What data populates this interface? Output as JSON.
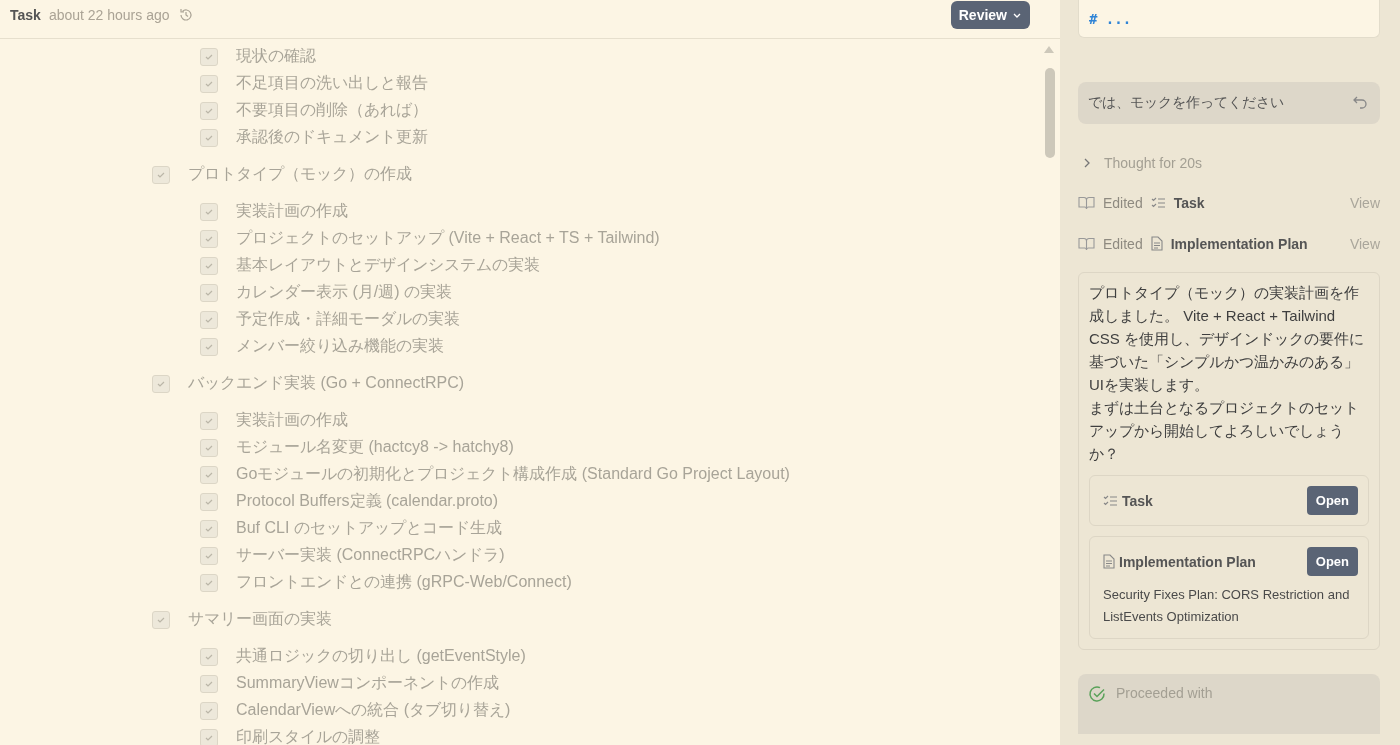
{
  "header": {
    "title": "Task",
    "timestamp": "about 22 hours ago",
    "review_button": "Review"
  },
  "task_list": {
    "continued_items": [
      {
        "label": "現状の確認",
        "checked": true
      },
      {
        "label": "不足項目の洗い出しと報告",
        "checked": true
      },
      {
        "label": "不要項目の削除（あれば）",
        "checked": true
      },
      {
        "label": "承認後のドキュメント更新",
        "checked": true
      }
    ],
    "sections": [
      {
        "label": "プロトタイプ（モック）の作成",
        "checked": true,
        "children": [
          {
            "label": "実装計画の作成",
            "checked": true
          },
          {
            "label": "プロジェクトのセットアップ (Vite + React + TS + Tailwind)",
            "checked": true
          },
          {
            "label": "基本レイアウトとデザインシステムの実装",
            "checked": true
          },
          {
            "label": "カレンダー表示 (月/週) の実装",
            "checked": true
          },
          {
            "label": "予定作成・詳細モーダルの実装",
            "checked": true
          },
          {
            "label": "メンバー絞り込み機能の実装",
            "checked": true
          }
        ]
      },
      {
        "label": "バックエンド実装 (Go + ConnectRPC)",
        "checked": true,
        "children": [
          {
            "label": "実装計画の作成",
            "checked": true
          },
          {
            "label": "モジュール名変更 (hactcy8 -> hatchy8)",
            "checked": true
          },
          {
            "label": "Goモジュールの初期化とプロジェクト構成作成 (Standard Go Project Layout)",
            "checked": true
          },
          {
            "label": "Protocol Buffers定義 (calendar.proto)",
            "checked": true
          },
          {
            "label": "Buf CLI のセットアップとコード生成",
            "checked": true
          },
          {
            "label": "サーバー実装 (ConnectRPCハンドラ)",
            "checked": true
          },
          {
            "label": "フロントエンドとの連携 (gRPC-Web/Connect)",
            "checked": true
          }
        ]
      },
      {
        "label": "サマリー画面の実装",
        "checked": true,
        "children": [
          {
            "label": "共通ロジックの切り出し (getEventStyle)",
            "checked": true
          },
          {
            "label": "SummaryViewコンポーネントの作成",
            "checked": true
          },
          {
            "label": "CalendarViewへの統合 (タブ切り替え)",
            "checked": true
          },
          {
            "label": "印刷スタイルの調整",
            "checked": true
          }
        ]
      }
    ]
  },
  "chat": {
    "previous_card": {
      "text": "# ..."
    },
    "user_message": {
      "text": "では、モックを作ってください"
    },
    "thought": {
      "label": "Thought for 20s",
      "expanded": false
    },
    "edits": [
      {
        "action": "Edited",
        "kind": "task",
        "target": "Task",
        "link": "View"
      },
      {
        "action": "Edited",
        "kind": "plan",
        "target": "Implementation Plan",
        "link": "View"
      }
    ],
    "reply": {
      "paragraphs": [
        "プロトタイプ（モック）の実装計画を作成しました。 Vite + React + Tailwind CSS を使用し、デザインドックの要件に基づいた「シンプルかつ温かみのある」UIを実装します。",
        "まずは土台となるプロジェクトのセットアップから開始してよろしいでしょうか？"
      ],
      "artifacts": [
        {
          "kind": "task",
          "title": "Task",
          "button": "Open"
        },
        {
          "kind": "plan",
          "title": "Implementation Plan",
          "button": "Open",
          "description": "Security Fixes Plan: CORS Restriction and ListEvents Optimization"
        }
      ]
    },
    "status": {
      "label": "Proceeded with"
    }
  }
}
